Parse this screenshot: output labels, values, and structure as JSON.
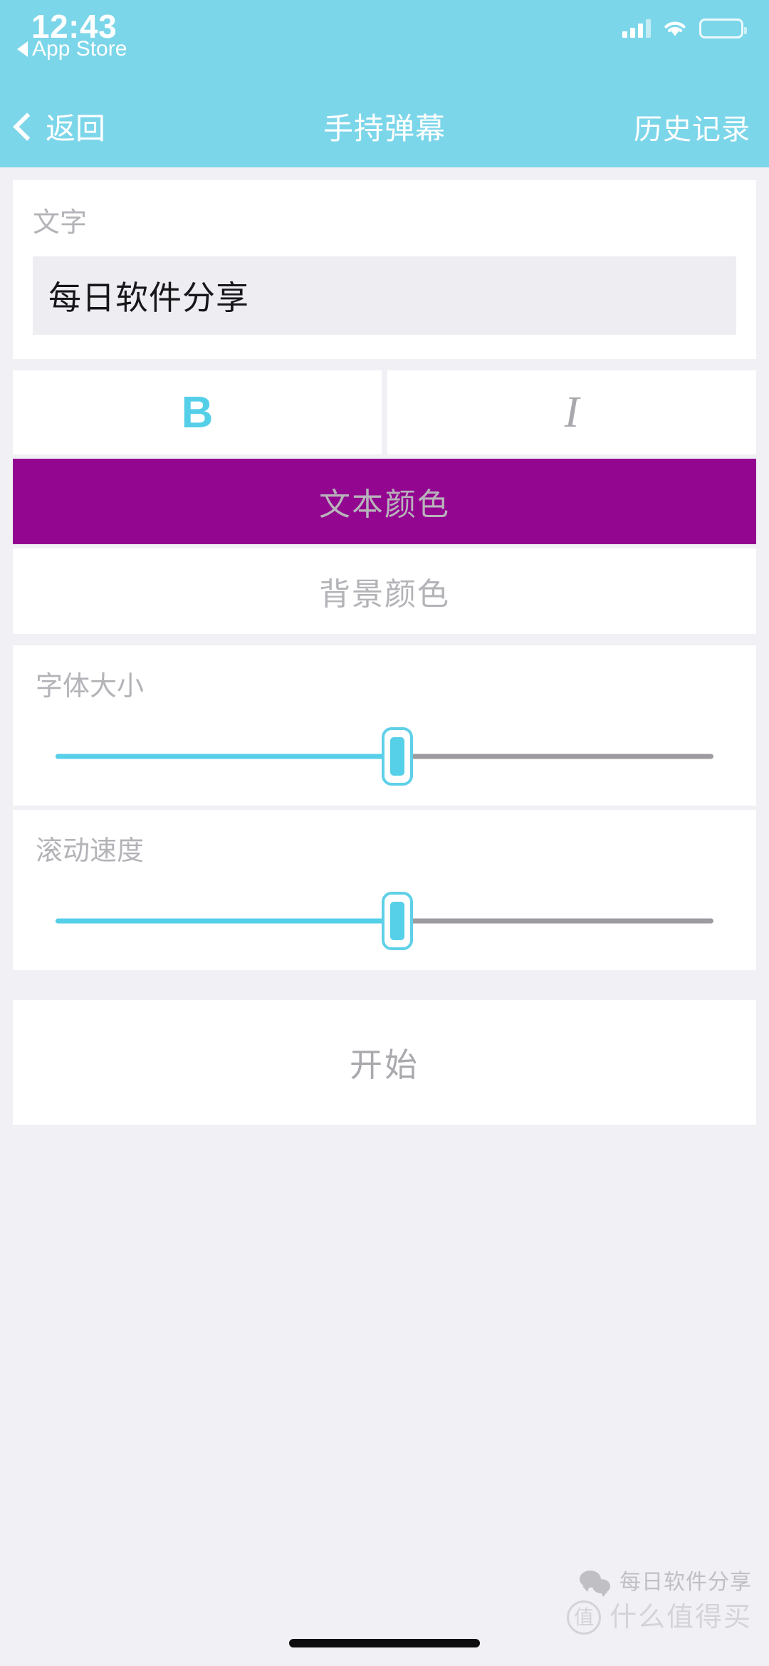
{
  "status_bar": {
    "time": "12:43",
    "back_app_label": "App Store",
    "signal_icon": "cellular-signal-icon",
    "wifi_icon": "wifi-icon",
    "battery_icon": "battery-icon",
    "battery_level_percent": 75
  },
  "nav_bar": {
    "back_label": "返回",
    "title": "手持弹幕",
    "history_label": "历史记录",
    "background_color": "#7cd6e9"
  },
  "form": {
    "text_field": {
      "label": "文字",
      "value": "每日软件分享"
    },
    "style_buttons": [
      {
        "label": "B",
        "name": "bold-button",
        "active": true,
        "color": "#55cfe8"
      },
      {
        "label": "I",
        "name": "italic-button",
        "active": false,
        "color": "#a8a8ad"
      }
    ],
    "text_color_button": {
      "label": "文本颜色",
      "background_color": "#930690",
      "text_color": "#b8b3bb"
    },
    "bg_color_button": {
      "label": "背景颜色",
      "background_color": "#ffffff",
      "text_color": "#b3b3b8"
    },
    "font_size_slider": {
      "label": "字体大小",
      "value_percent": 52,
      "fill_color": "#56cfe8",
      "track_color": "#9d9aa0"
    },
    "scroll_speed_slider": {
      "label": "滚动速度",
      "value_percent": 52,
      "fill_color": "#56cfe8",
      "track_color": "#9d9aa0"
    },
    "start_button": {
      "label": "开始",
      "text_color": "#a9a9ae"
    }
  },
  "watermark": {
    "wechat_icon": "wechat-icon",
    "account_name": "每日软件分享",
    "site_badge": "值",
    "site_name": "什么值得买"
  }
}
